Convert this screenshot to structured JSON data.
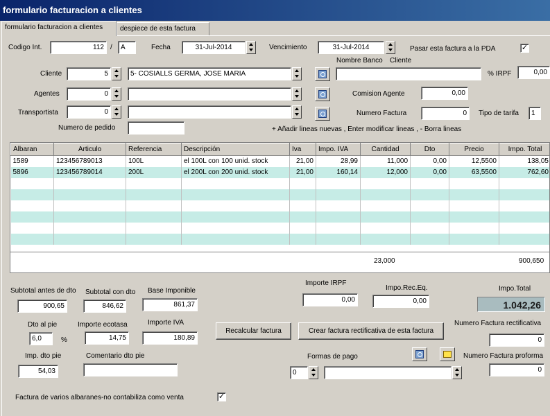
{
  "window": {
    "title": "formulario facturacion a clientes"
  },
  "tabs": [
    {
      "label": "formulario facturacion a clientes",
      "active": true
    },
    {
      "label": "despiece de esta factura",
      "active": false
    }
  ],
  "header": {
    "codigo_label": "Codigo Int.",
    "codigo_value": "112",
    "codigo_sep": "/",
    "codigo_series": "A",
    "fecha_label": "Fecha",
    "fecha_value": "31-Jul-2014",
    "vencimiento_label": "Vencimiento",
    "vencimiento_value": "31-Jul-2014",
    "pda_label": "Pasar esta factura a la PDA",
    "pda_checked": "✓",
    "nombre_banco_label": "Nombre Banco",
    "cliente_header_label": "Cliente",
    "cliente_label": "Cliente",
    "cliente_num": "5",
    "cliente_name": "5- COSIALLS GERMA, JOSE MARIA",
    "banco_value": "",
    "irpf_label": "% IRPF",
    "irpf_value": "0,00",
    "agentes_label": "Agentes",
    "agentes_num": "0",
    "agentes_name": "",
    "comision_label": "Comision Agente",
    "comision_value": "0,00",
    "transportista_label": "Transportista",
    "transportista_num": "0",
    "transportista_name": "",
    "numero_factura_label": "Numero Factura",
    "numero_factura_value": "0",
    "tipo_tarifa_label": "Tipo de tarifa",
    "tipo_tarifa_value": "1",
    "pedido_label": "Numero de pedido",
    "pedido_value": "",
    "hint": "+ Añadir lineas nuevas , Enter modificar lineas , - Borra lineas"
  },
  "lines": {
    "columns": [
      "Albaran",
      "Articulo",
      "Referencia",
      "Descripción",
      "Iva",
      "Impo. IVA",
      "Cantidad",
      "Dto",
      "Precio",
      "Impo. Total"
    ],
    "rows": [
      [
        "1589",
        "123456789013",
        "100L",
        "el 100L con 100 unid. stock",
        "21,00",
        "28,99",
        "11,000",
        "0,00",
        "12,5500",
        "138,05"
      ],
      [
        "5896",
        "123456789014",
        "200L",
        "el 200L con 200 unid. stock",
        "21,00",
        "160,14",
        "12,000",
        "0,00",
        "63,5500",
        "762,60"
      ]
    ],
    "total_cantidad": "23,000",
    "total_importe": "900,650"
  },
  "summary": {
    "subtotal_antes_label": "Subtotal antes de dto",
    "subtotal_antes_value": "900,65",
    "subtotal_con_label": "Subtotal con dto",
    "subtotal_con_value": "846,62",
    "base_label": "Base Imponible",
    "base_value": "861,37",
    "irpf_import_label": "Importe IRPF",
    "irpf_import_value": "0,00",
    "rec_label": "Impo.Rec.Eq.",
    "rec_value": "0,00",
    "total_label": "Impo.Total",
    "total_value": "1.042,26",
    "dto_pie_label": "Dto al pie",
    "dto_pie_value": "6,0",
    "percent": "%",
    "ecotasa_label": "Importe ecotasa",
    "ecotasa_value": "14,75",
    "iva_label": "Importe IVA",
    "iva_value": "180,89",
    "imp_dto_pie_label": "Imp. dto pie",
    "imp_dto_pie_value": "54,03",
    "comentario_label": "Comentario dto pie",
    "comentario_value": "",
    "recalcular_button": "Recalcular factura",
    "rectificativa_button": "Crear factura rectificativa de esta factura",
    "num_rectificativa_label": "Numero Factura rectificativa",
    "num_rectificativa_value": "0",
    "formas_pago_label": "Formas de pago",
    "formas_pago_num": "0",
    "formas_pago_name": "",
    "num_proforma_label": "Numero Factura proforma",
    "num_proforma_value": "0",
    "varios_albaranes_label": "Factura de varios albaranes-no contabiliza como venta",
    "varios_albaranes_checked": "✓"
  }
}
